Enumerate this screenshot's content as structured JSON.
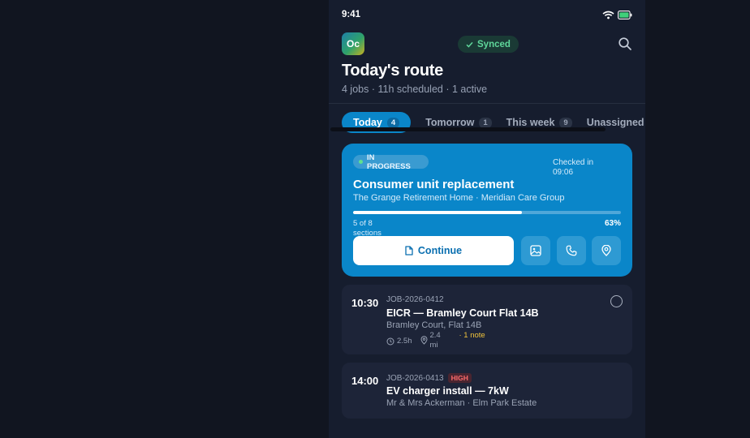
{
  "status_bar": {
    "time": "9:41"
  },
  "header": {
    "logo": "Oc",
    "sync_status": "Synced",
    "title": "Today's route",
    "subtitle": "4 jobs · 11h scheduled · 1 active"
  },
  "tabs": [
    {
      "label": "Today",
      "count": "4",
      "active": true
    },
    {
      "label": "Tomorrow",
      "count": "1"
    },
    {
      "label": "This week",
      "count": "9"
    },
    {
      "label": "Unassigned"
    }
  ],
  "active_job": {
    "status": "IN PROGRESS",
    "checked_in": "Checked in 09:06",
    "title": "Consumer unit replacement",
    "subtitle": "The Grange Retirement Home · Meridian Care Group",
    "progress_fraction": 0.63,
    "sections_label": "5 of 8 sections",
    "percent_label": "63%",
    "continue_label": "Continue"
  },
  "jobs": [
    {
      "time": "10:30",
      "id": "JOB-2026-0412",
      "title": "EICR — Bramley Court Flat 14B",
      "location": "Bramley Court, Flat 14B",
      "duration": "2.5h",
      "distance": "2.4 mi",
      "note": "· 1 note"
    },
    {
      "time": "14:00",
      "id": "JOB-2026-0413",
      "priority": "HIGH",
      "title": "EV charger install — 7kW",
      "location": "Mr & Mrs Ackerman · Elm Park Estate"
    }
  ],
  "colors": {
    "accent": "#0a86c9",
    "synced_text": "#5fd69a",
    "high_priority": "#ff6b6b",
    "note": "#f0c43c"
  },
  "icons": [
    "wifi-icon",
    "battery-icon",
    "search-icon",
    "check-icon",
    "document-icon",
    "image-icon",
    "phone-icon",
    "location-pin-icon",
    "clock-icon"
  ]
}
